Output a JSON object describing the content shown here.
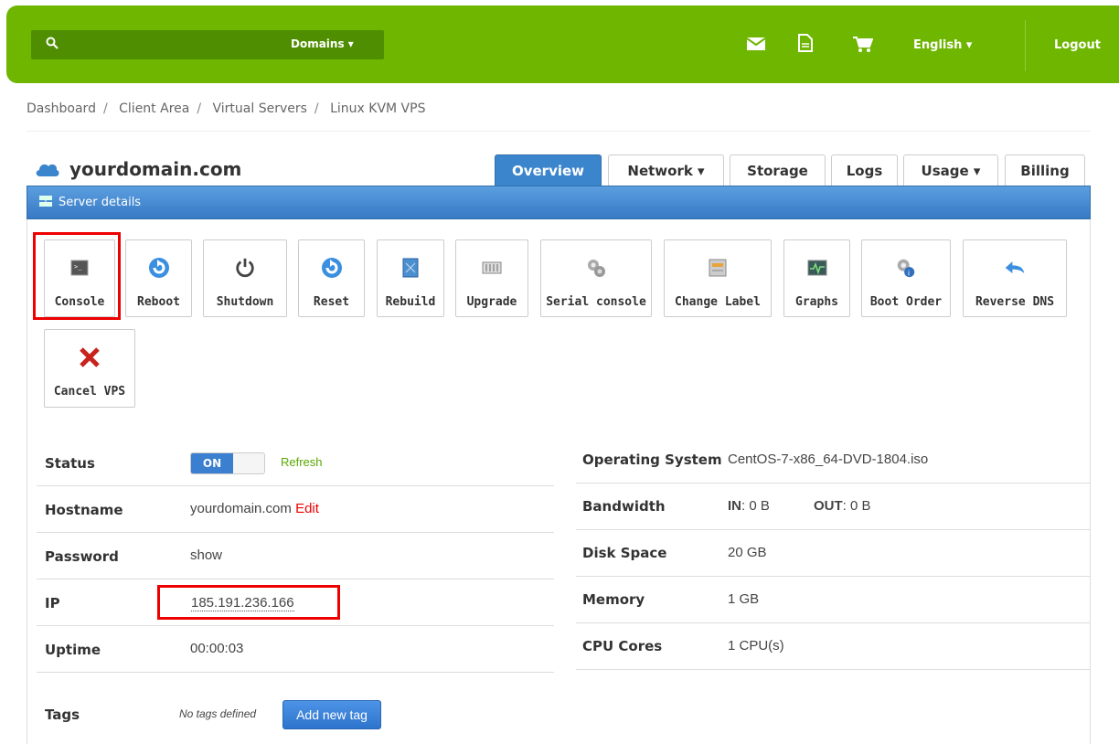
{
  "topbar": {
    "search_placeholder": "",
    "domains_label": "Domains ▾",
    "language_label": "English ▾",
    "logout_label": "Logout",
    "accent": "#6eb600"
  },
  "breadcrumb": [
    "Dashboard",
    "Client Area",
    "Virtual Servers",
    "Linux KVM VPS"
  ],
  "title": "yourdomain.com",
  "tabs": [
    {
      "label": "Overview",
      "active": true
    },
    {
      "label": "Network ▾"
    },
    {
      "label": "Storage"
    },
    {
      "label": "Logs"
    },
    {
      "label": "Usage ▾"
    },
    {
      "label": "Billing"
    }
  ],
  "panel_title": "Server details",
  "actions": [
    {
      "label": "Console",
      "icon": "console-icon"
    },
    {
      "label": "Reboot",
      "icon": "reboot-icon"
    },
    {
      "label": "Shutdown",
      "icon": "power-icon"
    },
    {
      "label": "Reset",
      "icon": "reset-icon"
    },
    {
      "label": "Rebuild",
      "icon": "rebuild-icon"
    },
    {
      "label": "Upgrade",
      "icon": "upgrade-icon"
    },
    {
      "label": "Serial console",
      "icon": "serial-console-icon"
    },
    {
      "label": "Change Label",
      "icon": "label-icon"
    },
    {
      "label": "Graphs",
      "icon": "graphs-icon"
    },
    {
      "label": "Boot Order",
      "icon": "boot-order-icon"
    },
    {
      "label": "Reverse DNS",
      "icon": "reverse-dns-icon"
    },
    {
      "label": "Cancel VPS",
      "icon": "cancel-icon"
    }
  ],
  "left": {
    "status_label": "Status",
    "status_on": "ON",
    "refresh": "Refresh",
    "hostname_label": "Hostname",
    "hostname": "yourdomain.com",
    "edit": "Edit",
    "password_label": "Password",
    "password_show": "show",
    "ip_label": "IP",
    "ip": "185.191.236.166",
    "uptime_label": "Uptime",
    "uptime": "00:00:03",
    "tags_label": "Tags",
    "no_tags": "No tags defined",
    "add_tag": "Add new tag"
  },
  "right": {
    "os_label": "Operating System",
    "os": "CentOS-7-x86_64-DVD-1804.iso",
    "bandwidth_label": "Bandwidth",
    "in_label": "IN",
    "in_value": ": 0 B",
    "out_label": "OUT",
    "out_value": ": 0 B",
    "disk_label": "Disk Space",
    "disk": "20 GB",
    "memory_label": "Memory",
    "memory": "1 GB",
    "cpu_label": "CPU Cores",
    "cpu": "1 CPU(s)"
  }
}
